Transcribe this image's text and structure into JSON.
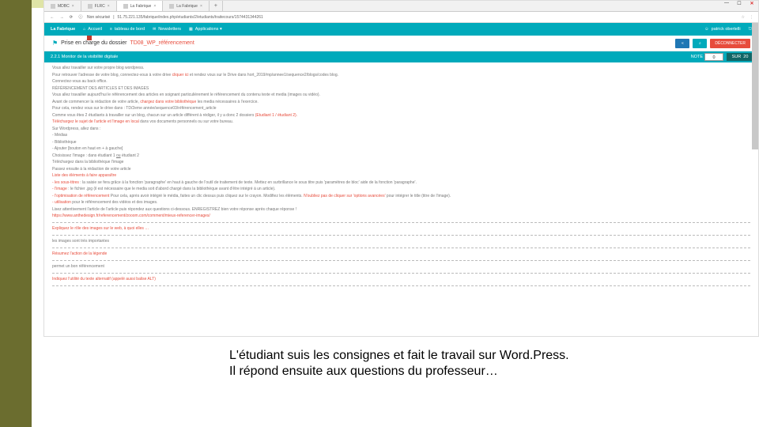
{
  "slide": {
    "caption_line1": "L'étudiant suis les consignes et fait le travail sur Word.Press.",
    "caption_line2": "Il répond ensuite aux questions du professeur…"
  },
  "browser": {
    "tabs": [
      {
        "favicon": "M",
        "label": "MDBC"
      },
      {
        "favicon": "F",
        "label": "FLRC"
      },
      {
        "favicon": "L",
        "label": "La Fabrique",
        "active": true
      },
      {
        "favicon": "L",
        "label": "La Fabrique"
      }
    ],
    "plus": "+",
    "window": {
      "min": "—",
      "max": "☐",
      "close": "✕"
    },
    "nav": {
      "back": "←",
      "fwd": "→",
      "reload": "⟳",
      "secure": "ⓘ",
      "insecure_label": "Non sécurisé",
      "sep": "|"
    },
    "url": "51.75.221.135/fabrique/index.php/etudiants/2/etudiants/traitecours/1574431344261",
    "right_icons": {
      "star": "☆",
      "menu": "⋮"
    }
  },
  "app": {
    "brand": "La Fabrique",
    "nav": [
      {
        "icon": "⌂",
        "label": "Accueil"
      },
      {
        "icon": "≡",
        "label": "tableau de bord"
      },
      {
        "icon": "✉",
        "label": "Newsletters"
      },
      {
        "icon": "▦",
        "label": "Applications ▾"
      }
    ],
    "user": {
      "icon": "☺",
      "name": "patrick obertelli",
      "logout": "⎋"
    }
  },
  "page": {
    "flag": "⚑",
    "title_prefix": "Prise en charge du dossier",
    "title_name": "TD08_WP_référencement",
    "btn_back": "«",
    "btn_search": "⌕",
    "btn_disconnect": "DÉCONNECTER"
  },
  "section": {
    "number": "2.2.1",
    "title": "Monitor de la visibilité digitale",
    "note_label": "NOTE",
    "note_value": "0",
    "sur_prefix": "SUR",
    "sur_value": "20"
  },
  "body": {
    "l1": "Vous allez travailler sur votre propre blog wordpress.",
    "l2a": "Pour retrouver l'adresse de votre blog, connectez-vous à votre drive ",
    "l2b": "cliquer ici",
    "l2c": " et rendez vous sur le Drive dans hort_2019/mp/annee1/sequence2/blogs/codes blog.",
    "l3": "Connectez-vous au back office.",
    "l4": "RÉFÉRENCEMENT DES ARTICLES ET DES IMAGES",
    "l5": "Vous allez travailler aujourd'hui le référencement des articles en soignant particulièrement le référencement du contenu texte et media (images ou vidéo).",
    "l6a": "Avant de commencer la rédaction de votre article, ",
    "l6b": "chargez dans votre bibliothèque",
    "l6c": " les media nécessaires à l'exercice.",
    "l7": "Pour cela, rendez vous sur le drive dans : TD/2eme année/sequence03/référencement_article",
    "l8a": "Comme vous êtes 2 étudiants à travailler sur un blog, chacun sur un article différent à rédiger, il y a donc 2 dossiers ",
    "l8b": "(Etudiant 1 / étudiant 2).",
    "l9a": "Téléchargez le sujet de l'article et l'image en local",
    "l9b": " dans vos documents personnels ou sur votre bureau.",
    "l10": "Sur Wordpress, allez dans :",
    "l11": "- Médias",
    "l12": "- Bibliothèque",
    "l13": "- Ajouter [bouton en haut en + à gauche]",
    "l14a": "Choisissez l'image : dans étudiant 1 ",
    "l14b": "ou",
    "l14c": " étudiant 2",
    "l15": "Téléchargez dans la bibliothèque l'image",
    "l16": "Passez ensuite à la rédaction de votre article",
    "l17": "Liste des éléments à faire apparaître",
    "l18a": "- les sous-titres",
    "l18b": " : la saisie se fera grâce à la fonction 'paragraphe' en haut à gauche de l'outil de traitement de texte. Mettez en surbrillance le sous titre puis 'paramètres de bloc' aide de la fonction 'paragraphe'.",
    "l19a": "- l'image",
    "l19b": " : le fichier .jpg (il est nécessaire que le media soit d'abord chargé dans la bibliothèque avant d'être intégré à un article).",
    "l20a": "- l'optimisation de référencement",
    "l20b": " Pour cela, après avoir intégré le média, faites un clic dessus puis cliquez sur le crayon. Modifiez les éléments. ",
    "l20c": "N'oubliez pas de cliquer sur 'options avancées'",
    "l20d": " pour intégrer le title (titre de l'image).",
    "l21a": "- utilisation",
    "l21b": " pour le référencement des vidéos et des images.",
    "l22": "Lisez attentivement l'article de l'article puis répondez aux questions ci-dessous. ENREGISTREZ bien votre réponse après chaque réponse !",
    "l23": "https://www.anthedesign.fr/referencement/zooom.com/comment/mieux-referencer-images/",
    "q1": "Expliquez le rôle des images sur le web, à quoi elles …",
    "a1": "les images sont très importantes",
    "q2": "Résumez l'action de la légende",
    "a2": "permet un bon référencement",
    "q3": "Indiquez l'utilité du texte alternatif (appelé aussi balise ALT)",
    "a3": ""
  }
}
